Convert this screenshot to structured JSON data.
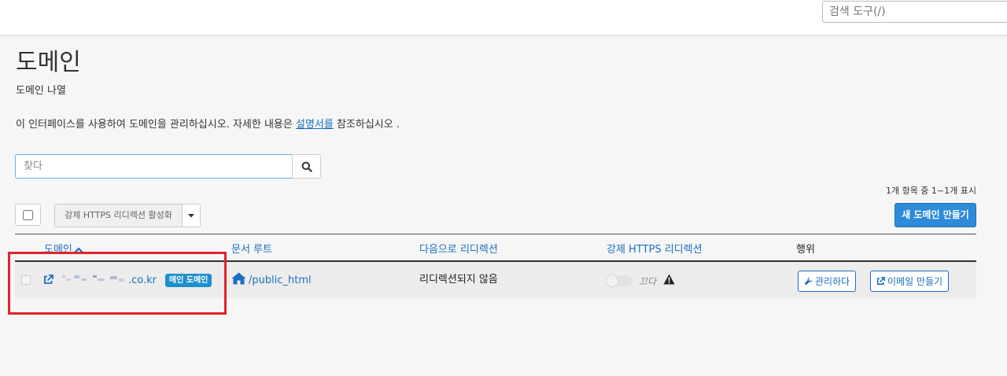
{
  "topbar": {
    "search_placeholder": "검색 도구(/)"
  },
  "page": {
    "title": "도메인",
    "subtitle": "도메인 나열",
    "description_before": "이 인터페이스를 사용하여 도메인을 관리하십시오. 자세한 내용은 ",
    "description_link": "설명서를",
    "description_after": " 참조하십시오 ."
  },
  "search": {
    "placeholder": "찾다"
  },
  "toolbar": {
    "count_text": "1개 항목 중 1~1개 표시",
    "https_toggle_label": "강제 HTTPS 리디렉션 활성화",
    "new_domain_label": "새 도메인 만들기"
  },
  "table": {
    "columns": [
      "도메인",
      "문서 루트",
      "다음으로 리디렉션",
      "강제 HTTPS 리디렉션",
      "행위"
    ],
    "rows": [
      {
        "domain_suffix": ".co.kr",
        "badge": "메인 도메인",
        "docroot": "/public_html",
        "redirect": "리디렉션되지 않음",
        "https_state": "끄다",
        "actions": [
          "관리하다",
          "이메일 만들기"
        ]
      }
    ]
  },
  "colors": {
    "accent": "#1b6ec2",
    "primary_button": "#2d8bd9",
    "badge": "#1d8fcc",
    "highlight": "#e0232b"
  }
}
